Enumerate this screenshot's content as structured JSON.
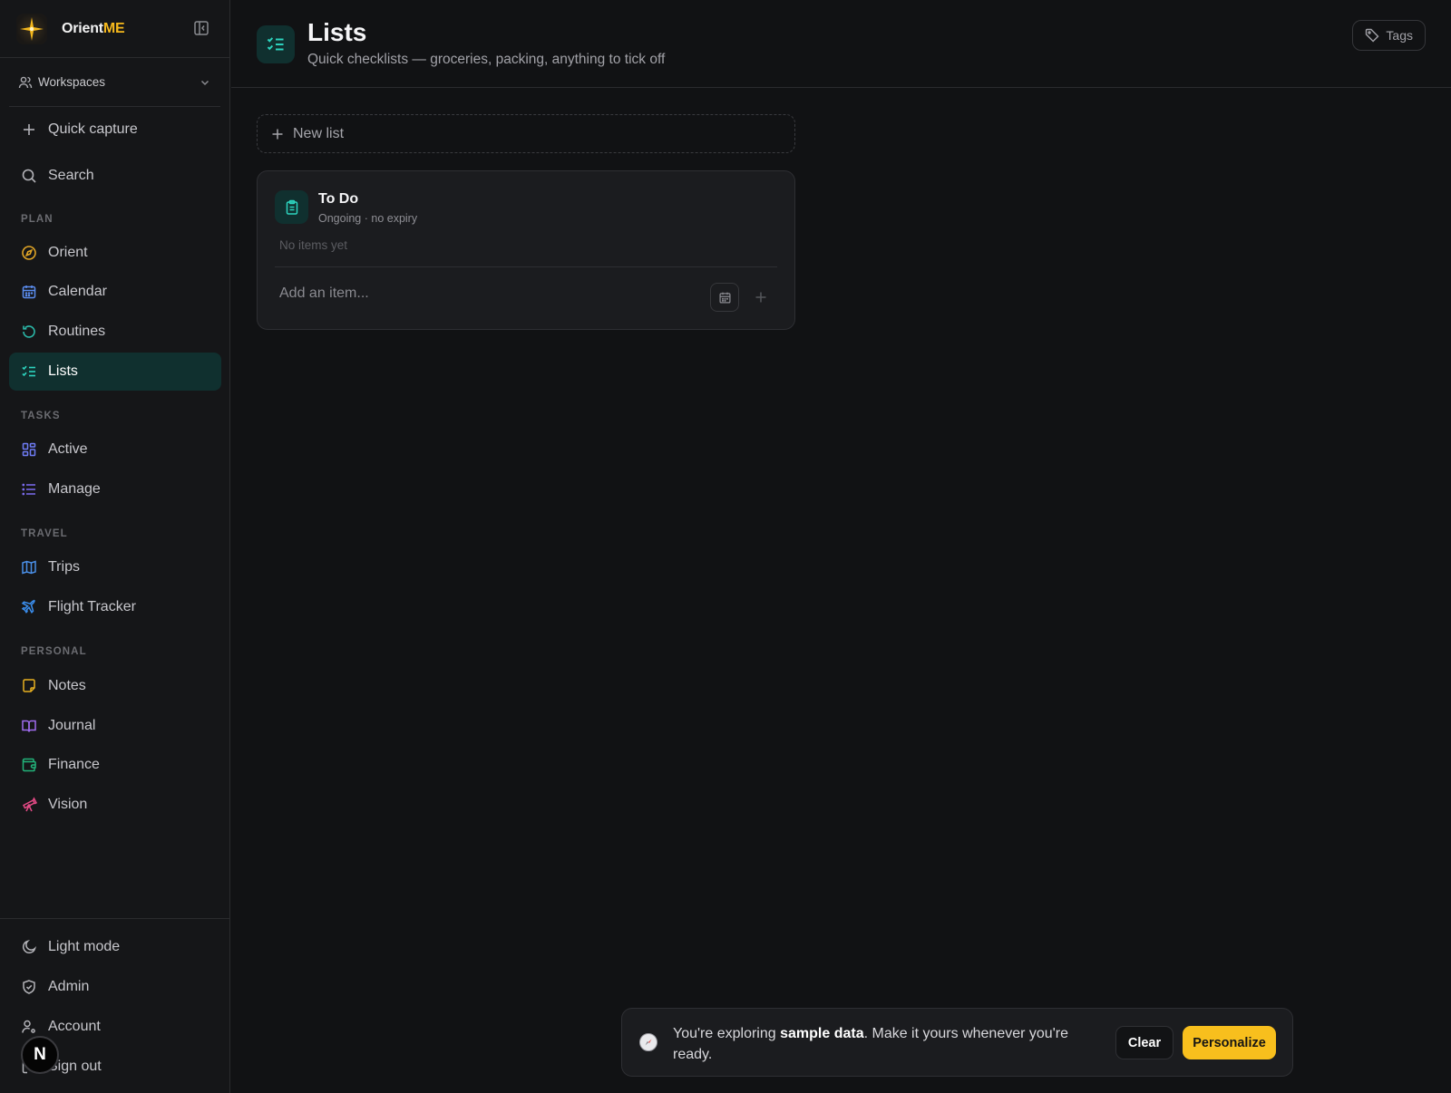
{
  "brand": {
    "name_prefix": "Orient",
    "name_suffix": "ME"
  },
  "sidebar": {
    "workspaces_label": "Workspaces",
    "quick_capture": "Quick capture",
    "search": "Search",
    "sections": {
      "plan": "PLAN",
      "tasks": "TASKS",
      "travel": "TRAVEL",
      "personal": "PERSONAL"
    },
    "items": {
      "orient": "Orient",
      "calendar": "Calendar",
      "routines": "Routines",
      "lists": "Lists",
      "active": "Active",
      "manage": "Manage",
      "trips": "Trips",
      "flight_tracker": "Flight Tracker",
      "notes": "Notes",
      "journal": "Journal",
      "finance": "Finance",
      "vision": "Vision"
    },
    "bottom": {
      "light_mode": "Light mode",
      "admin": "Admin",
      "account": "Account",
      "sign_out": "Sign out"
    },
    "avatar_letter": "N"
  },
  "header": {
    "title": "Lists",
    "subtitle": "Quick checklists — groceries, packing, anything to tick off",
    "tags_label": "Tags"
  },
  "main": {
    "new_list_label": "New list",
    "list_card": {
      "title": "To Do",
      "meta": "Ongoing · no expiry",
      "empty_text": "No items yet",
      "add_placeholder": "Add an item..."
    }
  },
  "toast": {
    "text_before": "You're exploring ",
    "text_bold": "sample data",
    "text_after": ". Make it yours whenever you're ready.",
    "clear_label": "Clear",
    "personalize_label": "Personalize"
  },
  "colors": {
    "accent_yellow": "#f5b81c",
    "accent_teal": "#2dd4bf",
    "active_bg": "#10302f",
    "background": "#111214"
  }
}
